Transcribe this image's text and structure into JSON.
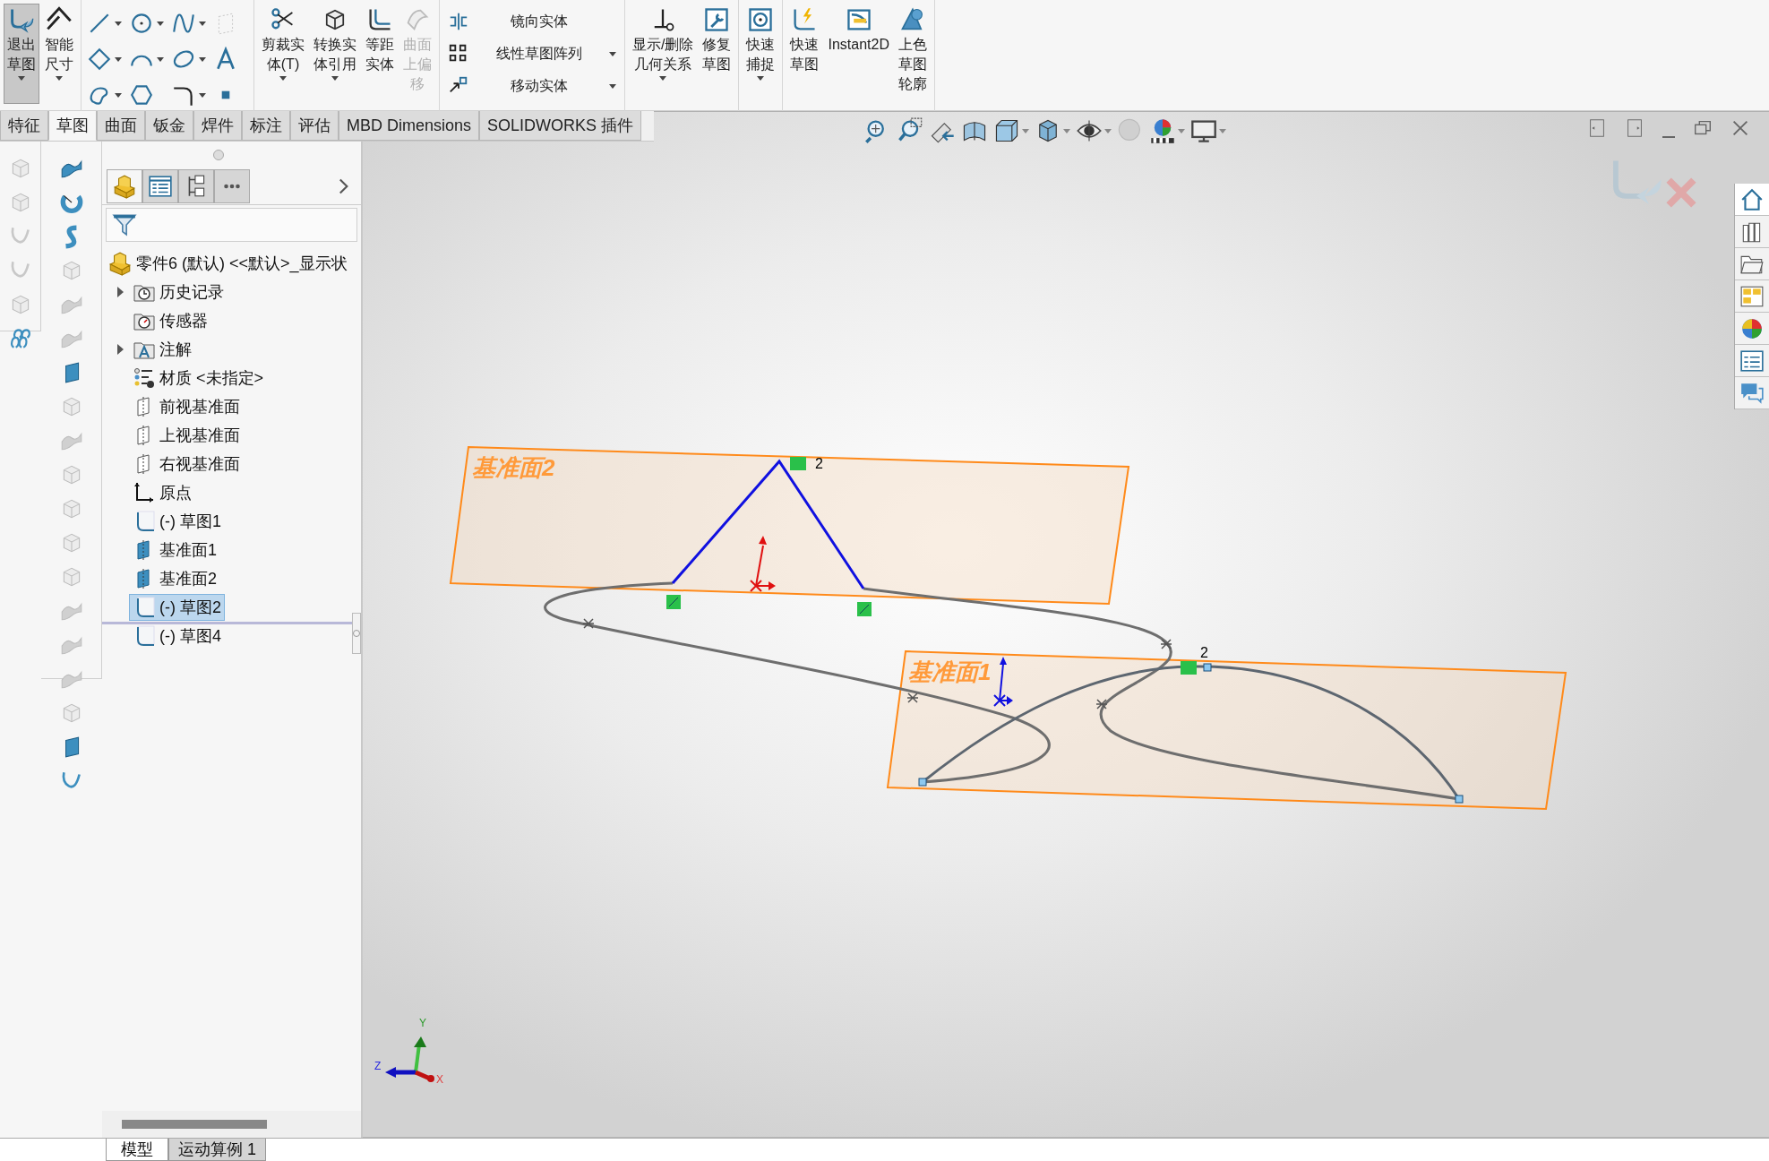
{
  "ribbon": {
    "groups": [
      {
        "kind": "large",
        "items": [
          {
            "lines": [
              "退出",
              "草图"
            ],
            "selected": true,
            "disabled": false
          },
          {
            "lines": [
              "智能",
              "尺寸"
            ],
            "selected": false,
            "disabled": false
          }
        ]
      },
      {
        "kind": "grid"
      },
      {
        "kind": "large",
        "items": [
          {
            "lines": [
              "剪裁实",
              "体(T)"
            ],
            "selected": false,
            "disabled": false
          },
          {
            "lines": [
              "转换实",
              "体引用"
            ],
            "selected": false,
            "disabled": false
          },
          {
            "lines": [
              "等距",
              "实体"
            ],
            "selected": false,
            "disabled": false
          },
          {
            "lines": [
              "曲面",
              "上偏",
              "移"
            ],
            "selected": false,
            "disabled": true
          }
        ]
      },
      {
        "kind": "list",
        "items": [
          {
            "lines": [
              "镜向实体"
            ],
            "disabled": false
          },
          {
            "lines": [
              "线性草图阵列"
            ],
            "disabled": false
          },
          {
            "lines": [
              "移动实体"
            ],
            "disabled": false
          }
        ]
      },
      {
        "kind": "large",
        "items": [
          {
            "lines": [
              "显示/删除",
              "几何关系"
            ],
            "selected": false,
            "disabled": false
          },
          {
            "lines": [
              "修复",
              "草图"
            ],
            "selected": false,
            "disabled": false
          }
        ]
      },
      {
        "kind": "large",
        "items": [
          {
            "lines": [
              "快速",
              "捕捉"
            ],
            "selected": false,
            "disabled": false
          }
        ]
      },
      {
        "kind": "large",
        "items": [
          {
            "lines": [
              "快速",
              "草图"
            ],
            "selected": false,
            "disabled": false
          },
          {
            "lines": [
              "Instant2D"
            ],
            "selected": false,
            "disabled": false
          },
          {
            "lines": [
              "上色",
              "草图",
              "轮廓"
            ],
            "selected": false,
            "disabled": false
          }
        ]
      }
    ]
  },
  "tabs": [
    {
      "label": "特征",
      "selected": false
    },
    {
      "label": "草图",
      "selected": true
    },
    {
      "label": "曲面",
      "selected": false
    },
    {
      "label": "钣金",
      "selected": false
    },
    {
      "label": "焊件",
      "selected": false
    },
    {
      "label": "标注",
      "selected": false
    },
    {
      "label": "评估",
      "selected": false
    },
    {
      "label": "MBD Dimensions",
      "selected": false
    },
    {
      "label": "SOLIDWORKS 插件",
      "selected": false
    }
  ],
  "left_toolbar": {
    "column_1": [
      {
        "kind": "box",
        "disabled": true
      },
      {
        "kind": "box",
        "disabled": true
      },
      {
        "kind": "curve",
        "disabled": true
      },
      {
        "kind": "curve",
        "disabled": true
      },
      {
        "kind": "box",
        "disabled": true
      },
      {
        "kind": "helix",
        "disabled": false
      }
    ],
    "column_2": [
      {
        "kind": "surface",
        "disabled": false
      },
      {
        "kind": "revolve",
        "disabled": false
      },
      {
        "kind": "sweep",
        "disabled": false
      },
      {
        "kind": "box",
        "disabled": true
      },
      {
        "kind": "surface",
        "disabled": true
      },
      {
        "kind": "surface",
        "disabled": true
      },
      {
        "kind": "plane",
        "disabled": false
      },
      {
        "kind": "box",
        "disabled": true
      },
      {
        "kind": "surface",
        "disabled": true
      },
      {
        "kind": "box",
        "disabled": true
      },
      {
        "kind": "box",
        "disabled": true
      },
      {
        "kind": "box",
        "disabled": true
      },
      {
        "kind": "box",
        "disabled": true
      },
      {
        "kind": "surface",
        "disabled": true
      },
      {
        "kind": "surface",
        "disabled": true
      },
      {
        "kind": "surface",
        "disabled": true
      },
      {
        "kind": "box",
        "disabled": true
      },
      {
        "kind": "plane",
        "disabled": false
      },
      {
        "kind": "curve",
        "disabled": false
      }
    ]
  },
  "feature_manager": {
    "panel_tabs": [
      {
        "selected": true
      },
      {
        "selected": false
      },
      {
        "selected": false
      },
      {
        "selected": false
      }
    ],
    "root": {
      "label": "零件6 (默认) <<默认>_显示状",
      "children": [
        {
          "kind": "history",
          "label": "历史记录",
          "expanded": false,
          "selected": false
        },
        {
          "kind": "sensor",
          "label": "传感器",
          "selected": false
        },
        {
          "kind": "annotation",
          "label": "注解",
          "expanded": false,
          "selected": false
        },
        {
          "kind": "material",
          "label": "材质 <未指定>",
          "selected": false
        },
        {
          "kind": "plane",
          "label": "前视基准面",
          "selected": false
        },
        {
          "kind": "plane",
          "label": "上视基准面",
          "selected": false
        },
        {
          "kind": "plane",
          "label": "右视基准面",
          "selected": false
        },
        {
          "kind": "origin",
          "label": "原点",
          "selected": false
        },
        {
          "kind": "sketch",
          "label": "(-) 草图1",
          "selected": false
        },
        {
          "kind": "refplane",
          "label": "基准面1",
          "selected": false
        },
        {
          "kind": "refplane",
          "label": "基准面2",
          "selected": false
        },
        {
          "kind": "sketch",
          "label": "(-) 草图2",
          "selected": true
        },
        {
          "kind": "sketch",
          "label": "(-) 草图4",
          "selected": false
        }
      ]
    }
  },
  "viewport": {
    "planes": [
      {
        "label": "基准面2"
      },
      {
        "label": "基准面1"
      }
    ],
    "relations": [
      {
        "label": "2"
      },
      {
        "label": "2"
      }
    ],
    "triad": {
      "x": "X",
      "y": "Y",
      "z": "Z"
    },
    "task_pane": [
      {
        "selected": true
      },
      {
        "selected": false
      },
      {
        "selected": false
      },
      {
        "selected": false
      },
      {
        "selected": false
      },
      {
        "selected": false
      },
      {
        "selected": false
      }
    ]
  },
  "bottom_tabs": [
    {
      "label": "模型",
      "selected": true
    },
    {
      "label": "运动算例 1",
      "selected": false
    }
  ]
}
